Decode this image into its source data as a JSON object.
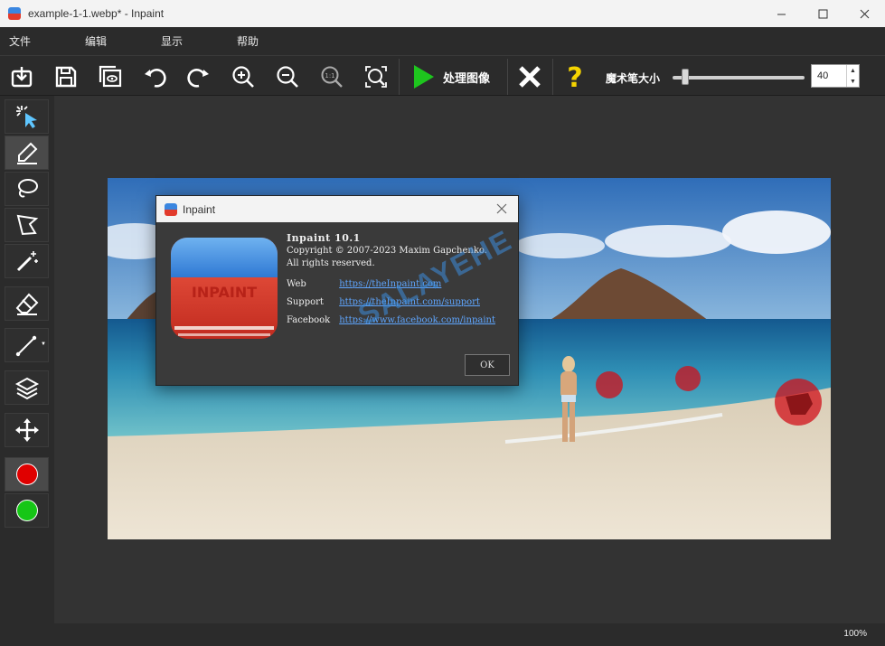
{
  "window": {
    "title": "example-1-1.webp* - Inpaint",
    "controls": [
      "minimize",
      "maximize",
      "close"
    ]
  },
  "menu": [
    "文件",
    "编辑",
    "显示",
    "帮助"
  ],
  "toolbar": {
    "buttons": [
      "open-icon",
      "save-icon",
      "save-as-icon",
      "undo-icon",
      "redo-icon",
      "zoom-in-icon",
      "zoom-out-icon",
      "actual-size-icon",
      "fit-icon"
    ],
    "process_label": "处理图像",
    "brush_size_label": "魔术笔大小",
    "brush_size_value": "40",
    "brush_size_fraction": 0.04
  },
  "tools": [
    "magic-wand-select-icon",
    "marker-icon",
    "lasso-icon",
    "polygon-lasso-icon",
    "magic-wand-icon",
    "eraser-icon",
    "line-icon",
    "layers-icon",
    "move-icon"
  ],
  "colors": {
    "red_marker": "#e00000",
    "green_marker": "#16c616",
    "accent_green": "#1ec51e",
    "help_yellow": "#f5d400",
    "link_blue": "#5fa6ff"
  },
  "status": {
    "zoom": "100%"
  },
  "about_dialog": {
    "title": "Inpaint",
    "product": "Inpaint 10.1",
    "copyright": "Copyright © 2007-2023 Maxim Gapchenko.",
    "rights": "All rights reserved.",
    "web_label": "Web",
    "web_link": "https://theInpaint.com",
    "support_label": "Support",
    "support_link": "https://theInpaint.com/support",
    "facebook_label": "Facebook",
    "facebook_link": "https://www.facebook.com/inpaint",
    "ok_label": "OK",
    "logo_text": "INPAINT",
    "watermark": "SALAYEHE"
  }
}
